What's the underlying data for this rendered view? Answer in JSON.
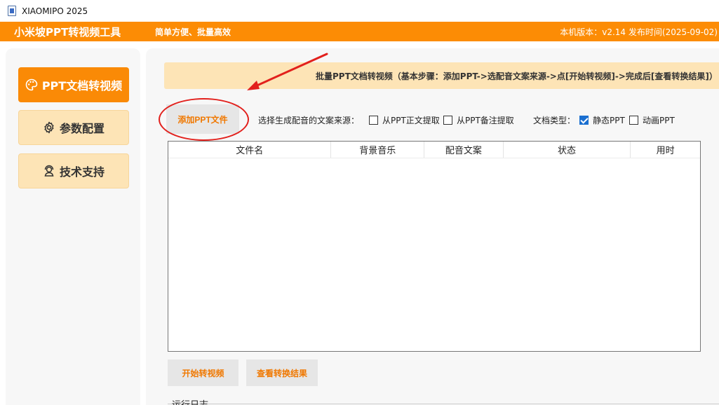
{
  "window": {
    "title": "XIAOMIPO 2025",
    "icon": "document-icon"
  },
  "header": {
    "app_name": "小米坡PPT转视频工具",
    "slogan": "简单方便、批量高效",
    "version_info": "本机版本：v2.14  发布时间(2025-09-02)",
    "color": "#fc8c05"
  },
  "nav": {
    "items": [
      {
        "label": "PPT文档转视频",
        "icon": "palette-icon",
        "active": true
      },
      {
        "label": "参数配置",
        "icon": "gear-icon",
        "active": false
      },
      {
        "label": "技术支持",
        "icon": "support-agent-icon",
        "active": false
      }
    ]
  },
  "main": {
    "banner": "批量PPT文档转视频（基本步骤：添加PPT->选配音文案来源->点[开始转视频]->完成后[查看转换结果]）",
    "add_button": "添加PPT文件",
    "source_label": "选择生成配音的文案来源：",
    "source_options": [
      {
        "label": "从PPT正文提取",
        "checked": false
      },
      {
        "label": "从PPT备注提取",
        "checked": false
      }
    ],
    "type_label": "文档类型：",
    "type_options": [
      {
        "label": "静态PPT",
        "checked": true
      },
      {
        "label": "动画PPT",
        "checked": false
      }
    ],
    "table": {
      "columns": [
        "文件名",
        "背景音乐",
        "配音文案",
        "状态",
        "用时"
      ],
      "rows": []
    },
    "start_button": "开始转视频",
    "view_button": "查看转换结果",
    "log_label": "运行日志"
  },
  "colors": {
    "accent": "#fa8a06",
    "nav_bg": "#fde4b6",
    "annotation": "#e2201c"
  }
}
